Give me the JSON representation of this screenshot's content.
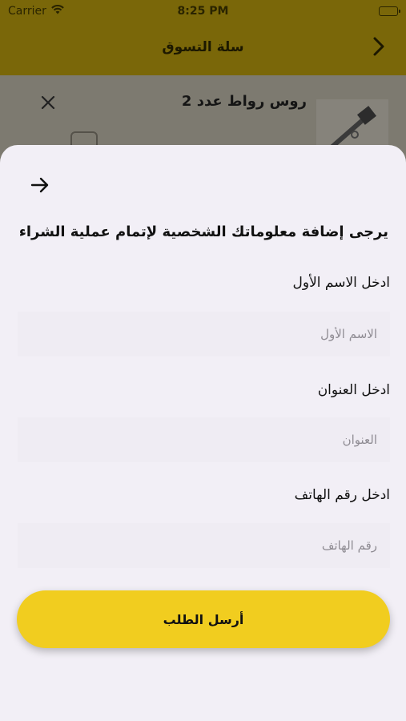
{
  "status_bar": {
    "carrier": "Carrier",
    "time": "8:25 PM"
  },
  "nav": {
    "title": "سلة التسوق"
  },
  "cart_item": {
    "name": "روس رواط عدد 2"
  },
  "sheet": {
    "title": "يرجى إضافة معلوماتك الشخصية لإتمام عملية الشراء",
    "fields": [
      {
        "label": "ادخل الاسم الأول",
        "placeholder": "الاسم الأول",
        "value": ""
      },
      {
        "label": "ادخل العنوان",
        "placeholder": "العنوان",
        "value": ""
      },
      {
        "label": "ادخل رقم الهاتف",
        "placeholder": "رقم الهاتف",
        "value": ""
      }
    ],
    "submit_label": "أرسل الطلب"
  },
  "colors": {
    "nav_background": "#7a6709",
    "accent": "#f1cd1f",
    "sheet_background": "#f2eff6"
  }
}
